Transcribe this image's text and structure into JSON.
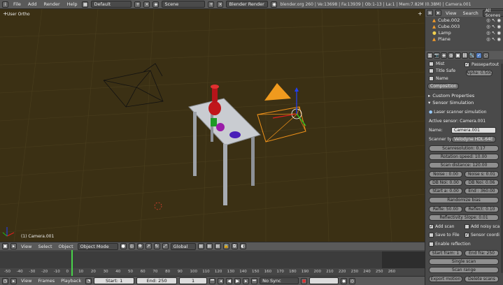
{
  "topbar": {
    "menus": [
      "File",
      "Add",
      "Render",
      "Help"
    ],
    "screen_layout": "Default",
    "scene": "Scene",
    "render_engine": "Blender Render",
    "stats": "blender.org 260 | Ve:13698 | Fa:13939 | Ob:1-13 | La:1 | Mem:7.82M (0.38M) | Camera.001"
  },
  "viewport": {
    "view_label": "User Ortho",
    "object_label": "(1) Camera.001"
  },
  "vp_header": {
    "menus": [
      "View",
      "Select",
      "Object"
    ],
    "mode": "Object Mode",
    "orientation": "Global"
  },
  "timeline": {
    "ticks": [
      "-50",
      "-40",
      "-30",
      "-20",
      "-10",
      "0",
      "10",
      "20",
      "30",
      "40",
      "50",
      "60",
      "70",
      "80",
      "90",
      "100",
      "110",
      "120",
      "130",
      "140",
      "150",
      "160",
      "170",
      "180",
      "190",
      "200",
      "210",
      "220",
      "230",
      "240",
      "250",
      "260"
    ],
    "current_frame": "1"
  },
  "tl_bottom": {
    "menus": [
      "View",
      "Frames",
      "Playback"
    ],
    "start": "Start: 1",
    "end": "End: 250",
    "sync": "No Sync"
  },
  "outliner": {
    "menus": [
      "View",
      "Search",
      "All Scenes"
    ],
    "items": [
      "Cube.002",
      "Cube.003",
      "Lamp",
      "Plane"
    ]
  },
  "props": {
    "mist": "Mist",
    "passepartout": "Passepartout",
    "title_safe": "Title Safe",
    "alpha": "Alpha: 0.500",
    "name": "Name",
    "composition": "Composition",
    "custom_properties": "Custom Properties",
    "sensor_simulation": "Sensor Simulation",
    "laser_scanner": "Laser scanner simulation",
    "active_sensor": "Active sensor: Camera.001",
    "name_label": "Name:",
    "name_value": "Camera.001",
    "scanner_label": "Scanner ty:",
    "scanner_value": "Velodyne HDL-64E",
    "scan_resolution": "Scanresolution: 0.17",
    "rotation_speed": "Rotation speed: 10.00",
    "scan_distance": "Scan distance: 120.00",
    "noise": "Noise : 0.00",
    "noise_s": "Noise s: 0.01",
    "db_noi_1": "DB Noi: 0.00",
    "db_noi_2": "DB Noi: 0.06",
    "start_a": "Start a: 0.00",
    "end_a": "End : 360.00",
    "randomize_bias": "Randomize bias",
    "refle": "Refle: 50.00",
    "reflect": "Reflect: 0.10",
    "reflectivity_slope": "Reflectivity Slope: 0.01",
    "add_scan": "Add scan",
    "add_noisy_scan": "Add noisy sca",
    "save_to_file": "Save to File",
    "sensor_coord": "Sensor coordi",
    "enable_reflection": "Enable reflection",
    "start_frame": "Start fram: 1",
    "end_frame": "End fra: 250",
    "single_scan": "Single scan",
    "scan_range": "Scan range",
    "export_motion": "Export motion",
    "delete_scans": "Delete scans"
  }
}
